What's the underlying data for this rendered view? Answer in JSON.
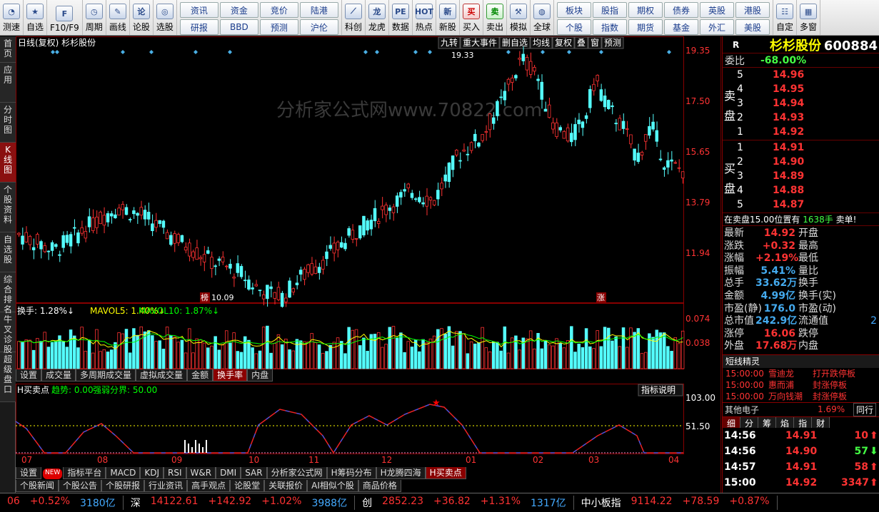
{
  "toolbar": {
    "left": [
      {
        "label": "测速",
        "icon": "speed-icon"
      },
      {
        "label": "自选",
        "icon": "star-icon"
      },
      {
        "label": "F10/F9",
        "icon": "f10-icon"
      },
      {
        "label": "周期",
        "icon": "clock-icon"
      },
      {
        "label": "画线",
        "icon": "pencil-icon"
      },
      {
        "label": "论股",
        "icon": "forum-icon"
      },
      {
        "label": "选股",
        "icon": "screener-icon"
      }
    ],
    "grid_a": [
      "资讯",
      "资金",
      "竞价",
      "陆港",
      "研报",
      "BBD",
      "预测",
      "沪伦"
    ],
    "mid": [
      {
        "label": "科创",
        "icon": "chart-icon"
      },
      {
        "label": "龙虎",
        "icon": "dragon-icon"
      },
      {
        "label": "数据",
        "icon": "pe-icon"
      },
      {
        "label": "热点",
        "icon": "hot-icon"
      },
      {
        "label": "新股",
        "icon": "ipo-icon"
      },
      {
        "label": "买入",
        "glyph": "买"
      },
      {
        "label": "卖出",
        "glyph": "卖"
      },
      {
        "label": "模拟",
        "icon": "hammer-icon"
      },
      {
        "label": "全球",
        "icon": "globe-icon"
      }
    ],
    "grid_b": [
      "板块",
      "股指",
      "期权",
      "债券",
      "英股",
      "港股",
      "个股",
      "指数",
      "期货",
      "基金",
      "外汇",
      "美股"
    ],
    "right": [
      {
        "label": "自定",
        "icon": "custom-icon"
      },
      {
        "label": "多窗",
        "icon": "multiwindow-icon"
      }
    ]
  },
  "left_tabs": [
    "首页",
    "应用",
    "分时图",
    "K线图",
    "个股资料",
    "自选股",
    "综合排名",
    "牛叉诊股",
    "超级盘口"
  ],
  "left_tab_active": 3,
  "chart": {
    "title": "日线(复权) 杉杉股份",
    "top_buttons": [
      "九转",
      "重大事件",
      "删自选",
      "均线",
      "复权",
      "叠",
      "窗",
      "预测"
    ],
    "price_ticks": [
      "19.35",
      "17.50",
      "15.65",
      "13.79",
      "11.94"
    ],
    "high_label": "19.33",
    "low_label": "10.09",
    "low_tag": "榜",
    "up_tag": "涨",
    "watermark": "分析家公式网www.70822.com",
    "ind1": {
      "name": "换手: 1.28%↓",
      "ma5": "MAVOL5: 1.40%↓",
      "ma10": "MAVOL10: 1.87%↓",
      "ticks": [
        "0.074",
        "0.038"
      ]
    },
    "sub1_tabs": [
      "设置",
      "成交量",
      "多周期成交量",
      "虚拟成交量",
      "金额",
      "换手率",
      "内盘"
    ],
    "sub1_active": 5,
    "ind2": {
      "name": "H买卖点",
      "trend": "趋势: 0.00",
      "border": "强弱分界: 50.00",
      "explain": "指标说明",
      "ticks": [
        "103.00",
        "51.50"
      ]
    },
    "months": [
      "07",
      "08",
      "09",
      "10",
      "11",
      "12",
      "01",
      "02",
      "03",
      "04"
    ],
    "sub2_tabs": [
      "设置",
      "指标平台",
      "MACD",
      "KDJ",
      "RSI",
      "W&R",
      "DMI",
      "SAR",
      "分析家公式网",
      "H筹码分布",
      "H龙腾四海",
      "H买卖点"
    ],
    "sub2_active": 11,
    "new_badge": "NEW",
    "bottom_tabs": [
      "个股新闻",
      "个股公告",
      "个股研报",
      "行业资讯",
      "高手观点",
      "论股堂",
      "关联报价",
      "AI相似个股",
      "商品价格"
    ]
  },
  "quote": {
    "r": "R",
    "name": "杉杉股份",
    "code": "600884",
    "weibi_label": "委比",
    "weibi": "-68.00%",
    "sell_label": [
      "卖",
      "盘"
    ],
    "buy_label": [
      "买",
      "盘"
    ],
    "sells": [
      {
        "n": "5",
        "p": "14.96"
      },
      {
        "n": "4",
        "p": "14.95"
      },
      {
        "n": "3",
        "p": "14.94"
      },
      {
        "n": "2",
        "p": "14.93"
      },
      {
        "n": "1",
        "p": "14.92"
      }
    ],
    "buys": [
      {
        "n": "1",
        "p": "14.91"
      },
      {
        "n": "2",
        "p": "14.90"
      },
      {
        "n": "3",
        "p": "14.89"
      },
      {
        "n": "4",
        "p": "14.88"
      },
      {
        "n": "5",
        "p": "14.87"
      }
    ],
    "notice_a": "在卖盘15.00位置有",
    "notice_b": "1638手",
    "notice_c": "卖单!",
    "stats": [
      [
        "最新",
        "14.92",
        "开盘",
        ""
      ],
      [
        "涨跌",
        "+0.32",
        "最高",
        ""
      ],
      [
        "涨幅",
        "+2.19%",
        "最低",
        ""
      ],
      [
        "振幅",
        "5.41%",
        "量比",
        ""
      ],
      [
        "总手",
        "33.62万",
        "换手",
        ""
      ],
      [
        "金额",
        "4.99亿",
        "换手(实)",
        ""
      ],
      [
        "市盈(静)",
        "176.0",
        "市盈(动)",
        ""
      ],
      [
        "总市值",
        "242.9亿",
        "流通值",
        "2"
      ],
      [
        "涨停",
        "16.06",
        "跌停",
        ""
      ],
      [
        "外盘",
        "17.68万",
        "内盘",
        ""
      ]
    ],
    "elf_title": "短线精灵",
    "elf": [
      [
        "15:00:00",
        "雪迪龙",
        "打开跌停板"
      ],
      [
        "15:00:00",
        "惠而浦",
        "封涨停板"
      ],
      [
        "15:00:00",
        "万向钱潮",
        "封涨停板"
      ]
    ],
    "sector": "其他电子",
    "sector_pct": "1.69%",
    "sector_btn": "同行",
    "tick_tabs": [
      "细",
      "分",
      "筹",
      "焰",
      "指",
      "财"
    ],
    "ticks": [
      [
        "14:56",
        "14.91",
        "10",
        "down"
      ],
      [
        "14:56",
        "14.90",
        "57",
        "up"
      ],
      [
        "14:57",
        "14.91",
        "58",
        "down"
      ],
      [
        "15:00",
        "14.92",
        "3347",
        "down"
      ]
    ]
  },
  "statusbar": [
    [
      "06",
      "+0.52%",
      "3180亿"
    ],
    [
      "深",
      "14122.61",
      "+142.92",
      "+1.02%",
      "3988亿"
    ],
    [
      "创",
      "2852.23",
      "+36.82",
      "+1.31%",
      "1317亿"
    ],
    [
      "中小板指",
      "9114.22",
      "+78.59",
      "+0.87%"
    ]
  ],
  "colors": {
    "up": "#ff3232",
    "down": "#54ffff",
    "ma": "#ffff00",
    "bg": "#000000"
  }
}
